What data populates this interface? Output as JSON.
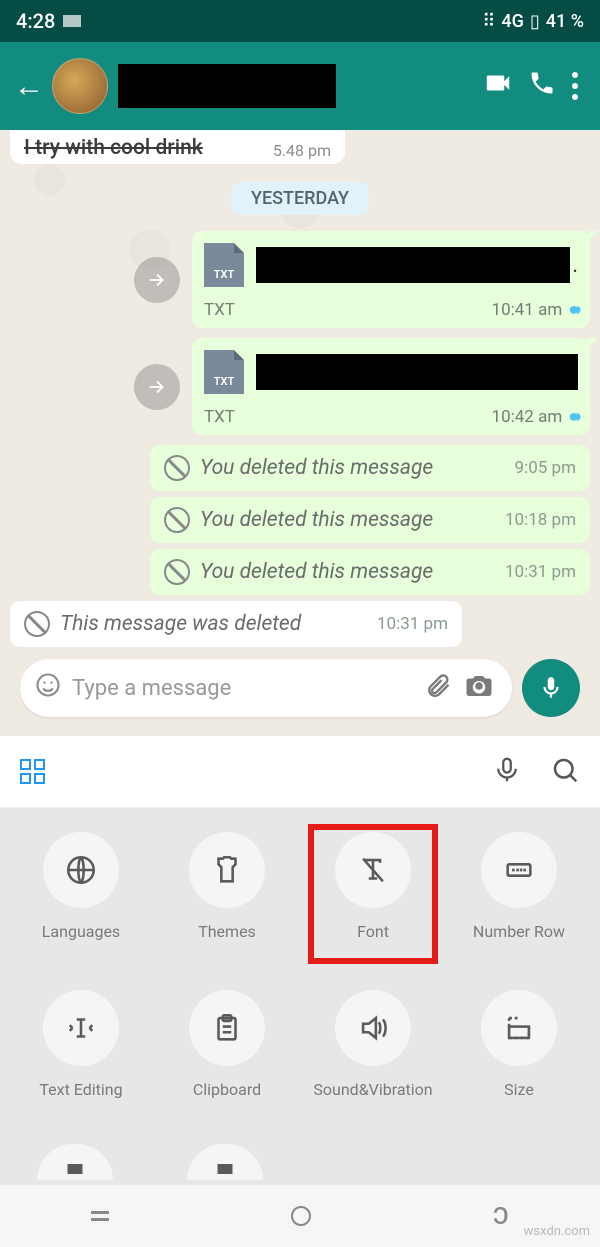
{
  "status": {
    "time": "4:28",
    "network": "4G",
    "battery": "41 %"
  },
  "cutoff_msg": {
    "text": "I try with cool drink",
    "time": "5.48 pm"
  },
  "date_separator": "YESTERDAY",
  "files": [
    {
      "ext": "TXT",
      "time": "10:41 am"
    },
    {
      "ext": "TXT",
      "time": "10:42 am"
    }
  ],
  "deleted_out": [
    {
      "text": "You deleted this message",
      "time": "9:05 pm"
    },
    {
      "text": "You deleted this message",
      "time": "10:18 pm"
    },
    {
      "text": "You deleted this message",
      "time": "10:31 pm"
    }
  ],
  "deleted_in": {
    "text": "This message was deleted",
    "time": "10:31 pm"
  },
  "input_placeholder": "Type a message",
  "keyboard_items": [
    "Languages",
    "Themes",
    "Font",
    "Number Row",
    "Text Editing",
    "Clipboard",
    "Sound&Vibration",
    "Size"
  ],
  "watermark": "wsxdn.com"
}
